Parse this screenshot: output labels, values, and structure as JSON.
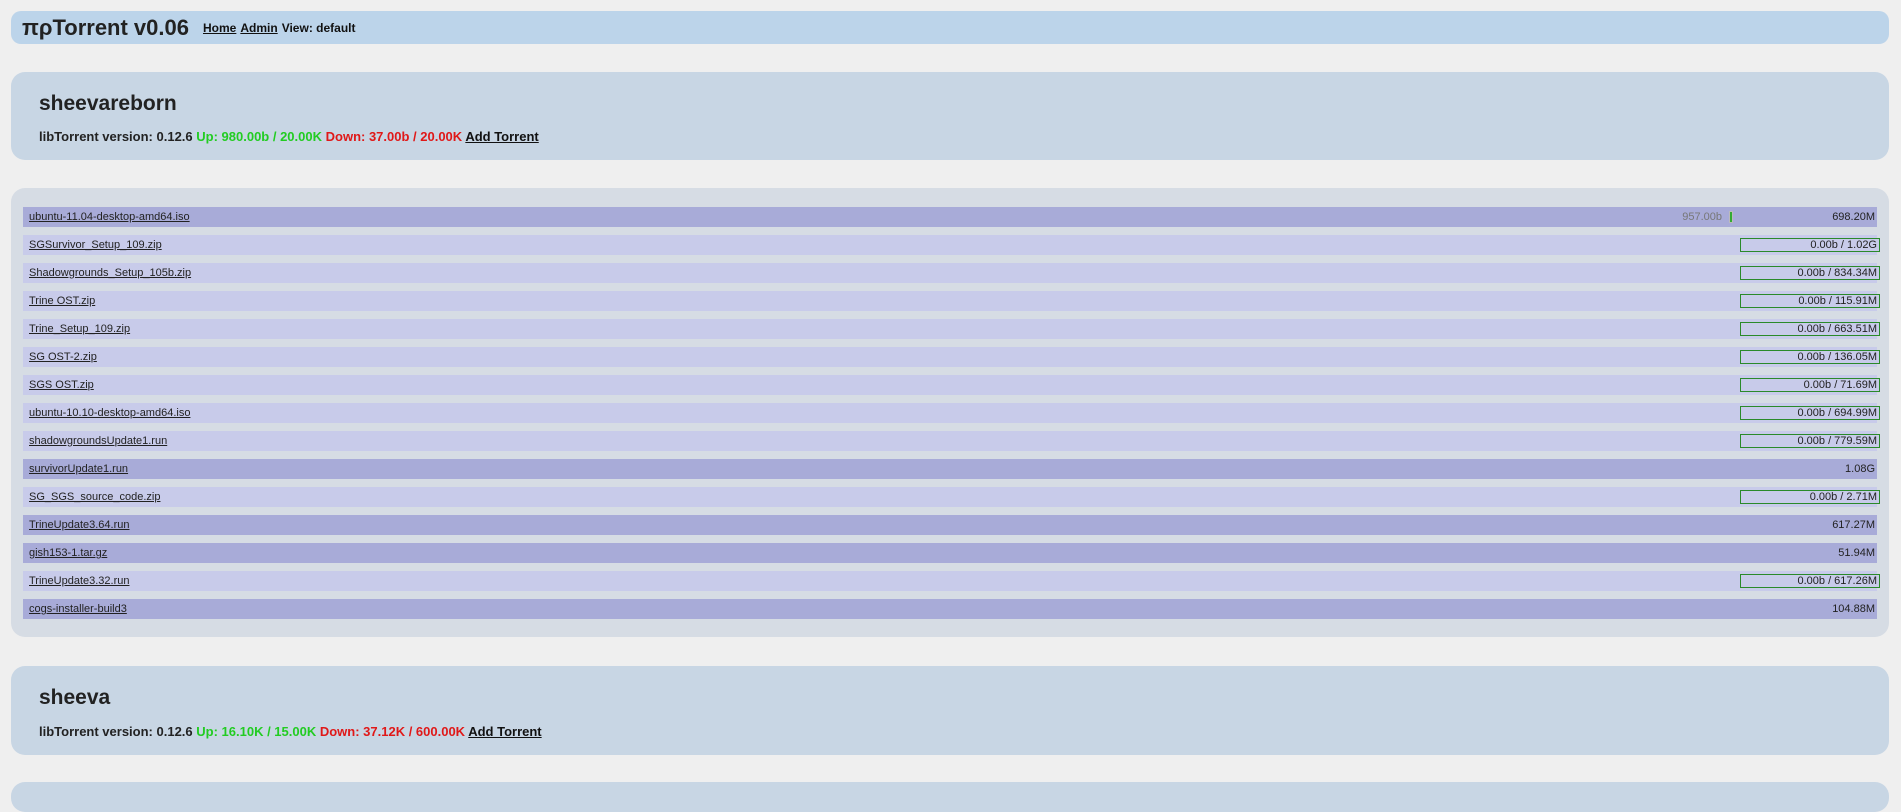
{
  "header": {
    "brand": "πρTorrent v0.06",
    "nav": [
      "Home",
      "Admin"
    ],
    "view_label": "View: default"
  },
  "servers": [
    {
      "name": "sheevareborn",
      "lib_label": "libTorrent version: 0.12.6",
      "up": "Up: 980.00b / 20.00K",
      "down": "Down: 37.00b / 20.00K",
      "add": "Add Torrent"
    },
    {
      "name": "sheeva",
      "lib_label": "libTorrent version: 0.12.6",
      "up": "Up: 16.10K / 15.00K",
      "down": "Down: 37.12K / 600.00K",
      "add": "Add Torrent"
    }
  ],
  "torrents": [
    {
      "name": "ubuntu-11.04-desktop-amd64.iso",
      "status": "seeding",
      "rate": "957.00b",
      "size": "698.20M"
    },
    {
      "name": "SGSurvivor_Setup_109.zip",
      "status": "stopped",
      "size": "0.00b / 1.02G"
    },
    {
      "name": "Shadowgrounds_Setup_105b.zip",
      "status": "stopped",
      "size": "0.00b / 834.34M"
    },
    {
      "name": "Trine OST.zip",
      "status": "stopped",
      "size": "0.00b / 115.91M"
    },
    {
      "name": "Trine_Setup_109.zip",
      "status": "stopped",
      "size": "0.00b / 663.51M"
    },
    {
      "name": "SG OST-2.zip",
      "status": "stopped",
      "size": "0.00b / 136.05M"
    },
    {
      "name": "SGS OST.zip",
      "status": "stopped",
      "size": "0.00b / 71.69M"
    },
    {
      "name": "ubuntu-10.10-desktop-amd64.iso",
      "status": "stopped",
      "size": "0.00b / 694.99M"
    },
    {
      "name": "shadowgroundsUpdate1.run",
      "status": "stopped",
      "size": "0.00b / 779.59M"
    },
    {
      "name": "survivorUpdate1.run",
      "status": "complete",
      "size": "1.08G"
    },
    {
      "name": "SG_SGS_source_code.zip",
      "status": "stopped",
      "size": "0.00b / 2.71M"
    },
    {
      "name": "TrineUpdate3.64.run",
      "status": "complete",
      "size": "617.27M"
    },
    {
      "name": "gish153-1.tar.gz",
      "status": "complete",
      "size": "51.94M"
    },
    {
      "name": "TrineUpdate3.32.run",
      "status": "stopped",
      "size": "0.00b / 617.26M"
    },
    {
      "name": "cogs-installer-build3",
      "status": "complete",
      "size": "104.88M"
    }
  ]
}
